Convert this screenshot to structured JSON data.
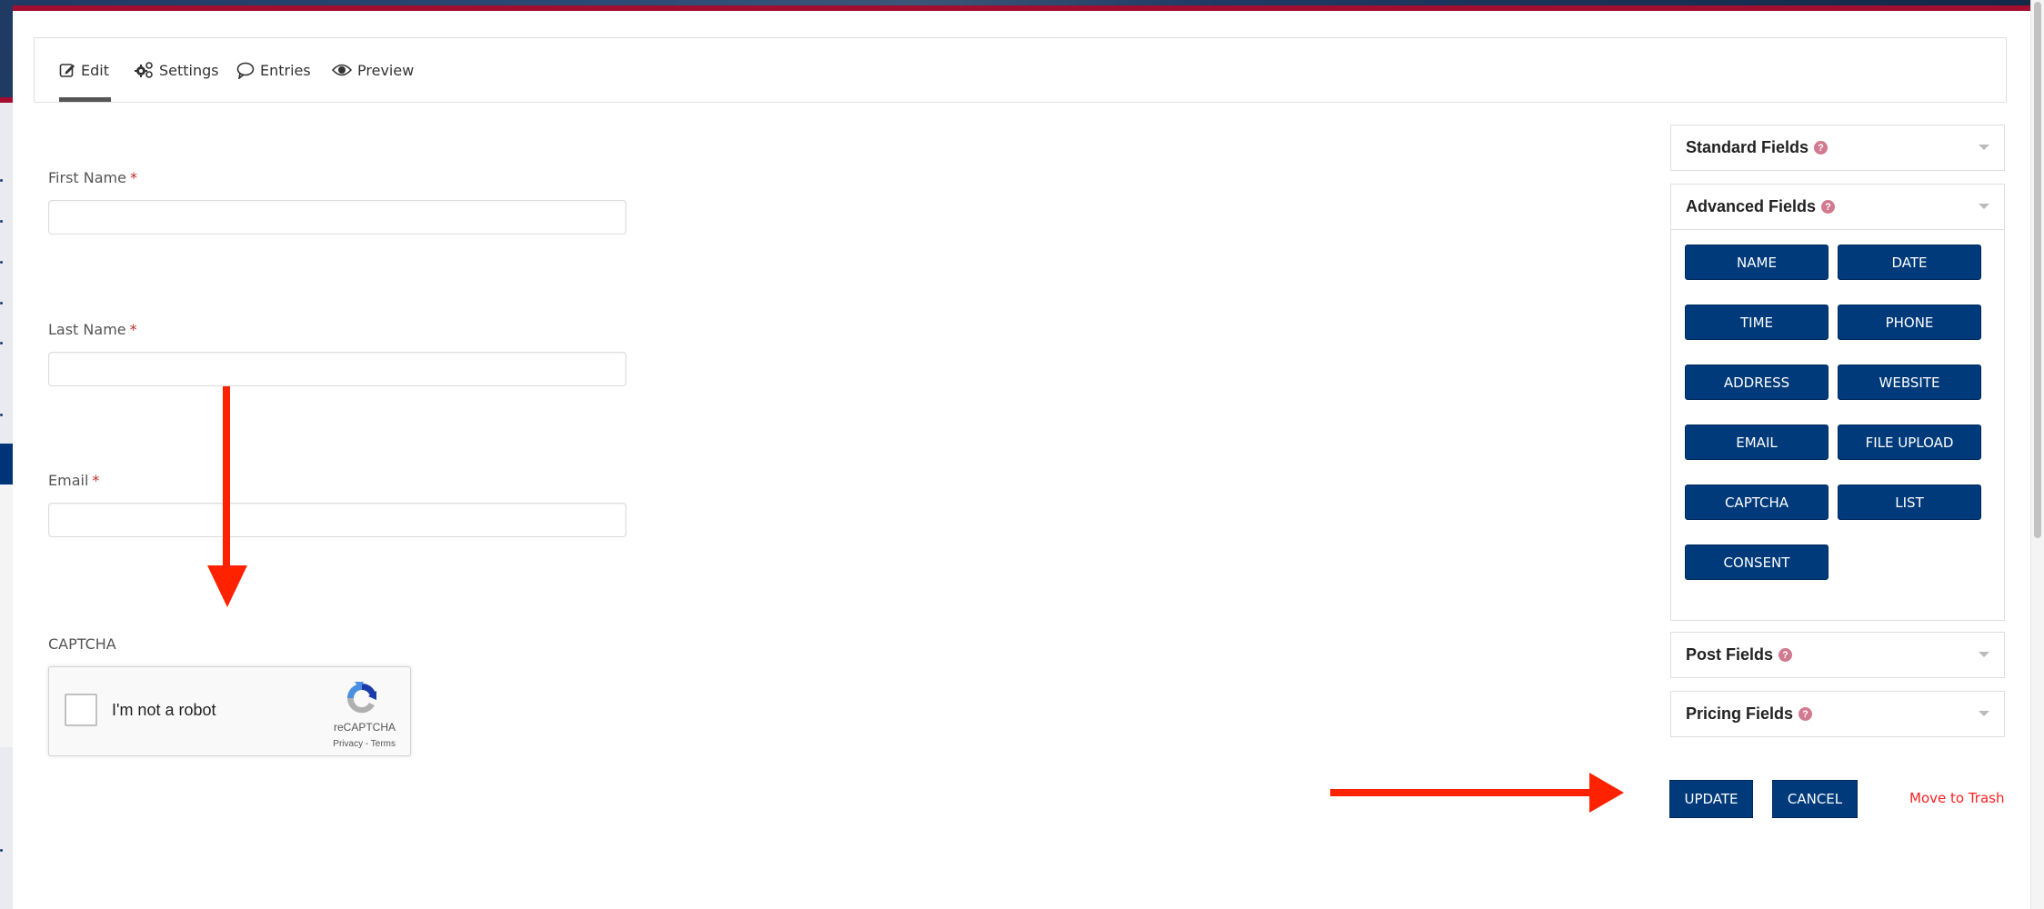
{
  "tabs": [
    {
      "label": "Edit",
      "icon": "edit-icon",
      "active": true
    },
    {
      "label": "Settings",
      "icon": "gears-icon",
      "active": false
    },
    {
      "label": "Entries",
      "icon": "comment-icon",
      "active": false
    },
    {
      "label": "Preview",
      "icon": "eye-icon",
      "active": false
    }
  ],
  "form": {
    "fields": [
      {
        "label": "First Name",
        "required": "*",
        "value": ""
      },
      {
        "label": "Last Name",
        "required": "*",
        "value": ""
      },
      {
        "label": "Email",
        "required": "*",
        "value": ""
      }
    ],
    "captcha": {
      "label": "CAPTCHA",
      "checkbox_text": "I'm not a robot",
      "brand": "reCAPTCHA",
      "links": "Privacy - Terms",
      "checked": false
    }
  },
  "panel": {
    "sections": [
      {
        "title": "Standard Fields",
        "help": "?"
      },
      {
        "title": "Advanced Fields",
        "help": "?"
      },
      {
        "title": "Post Fields",
        "help": "?"
      },
      {
        "title": "Pricing Fields",
        "help": "?"
      }
    ],
    "advanced_buttons": [
      "NAME",
      "DATE",
      "TIME",
      "PHONE",
      "ADDRESS",
      "WEBSITE",
      "EMAIL",
      "FILE UPLOAD",
      "CAPTCHA",
      "LIST",
      "CONSENT"
    ]
  },
  "actions": {
    "update_label": "UPDATE",
    "cancel_label": "CANCEL",
    "trash_label": "Move to Trash"
  },
  "colors": {
    "brand_navy": "#003a7a",
    "accent_red": "#a30d2f",
    "annotation_arrow": "#ff2200",
    "trash_link": "#ff2020",
    "help_icon": "#d17a8f"
  }
}
